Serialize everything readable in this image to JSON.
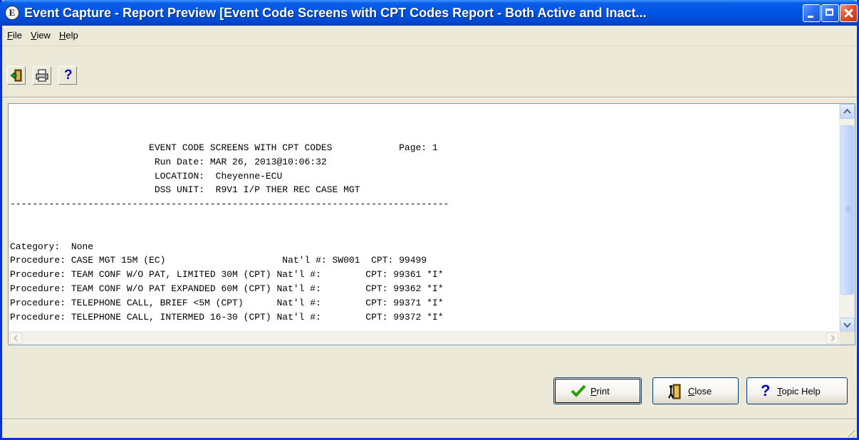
{
  "window": {
    "title": "Event Capture - Report Preview [Event Code Screens with CPT Codes Report - Both Active and Inact...",
    "icon_letter": "E"
  },
  "menu": {
    "file": "F",
    "file_rest": "ile",
    "view": "V",
    "view_rest": "iew",
    "help": "H",
    "help_rest": "elp"
  },
  "toolbar": {
    "exit_icon": "exit-door-icon",
    "print_icon": "printer-icon",
    "help_glyph": "?"
  },
  "report": {
    "lines": [
      "                         EVENT CODE SCREENS WITH CPT CODES            Page: 1",
      "                          Run Date: MAR 26, 2013@10:06:32",
      "                          LOCATION:  Cheyenne-ECU",
      "                          DSS UNIT:  R9V1 I/P THER REC CASE MGT",
      "-------------------------------------------------------------------------------",
      "",
      "",
      "Category:  None",
      "Procedure: CASE MGT 15M (EC)                     Nat'l #: SW001  CPT: 99499",
      "Procedure: TEAM CONF W/O PAT, LIMITED 30M (CPT) Nat'l #:        CPT: 99361 *I*",
      "Procedure: TEAM CONF W/O PAT EXPANDED 60M (CPT) Nat'l #:        CPT: 99362 *I*",
      "Procedure: TELEPHONE CALL, BRIEF <5M (CPT)      Nat'l #:        CPT: 99371 *I*",
      "Procedure: TELEPHONE CALL, INTERMED 16-30 (CPT) Nat'l #:        CPT: 99372 *I*"
    ]
  },
  "buttons": {
    "print_ul": "P",
    "print_rest": "rint",
    "close_ul": "C",
    "close_rest": "lose",
    "help_glyph": "?",
    "help_ul": "T",
    "help_rest": "opic Help"
  },
  "colors": {
    "titlebar": "#0054e3",
    "accent_green": "#2aa000",
    "help_blue": "#0000c8"
  }
}
